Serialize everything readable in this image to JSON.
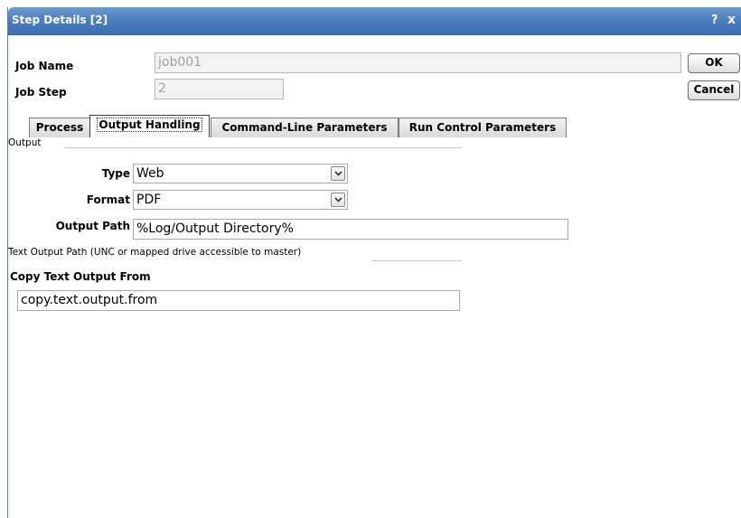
{
  "window": {
    "title": "Step Details [2]",
    "help_label": "?",
    "close_label": "x"
  },
  "header": {
    "job_name_label": "Job Name",
    "job_name_value": "job001",
    "job_step_label": "Job Step",
    "job_step_value": "2",
    "ok_label": "OK",
    "cancel_label": "Cancel"
  },
  "tabs": [
    {
      "label": "Process"
    },
    {
      "label": "Output Handling",
      "active": true
    },
    {
      "label": "Command-Line Parameters"
    },
    {
      "label": "Run Control Parameters"
    }
  ],
  "output": {
    "section_label": "Output",
    "type_label": "Type",
    "type_value": "Web",
    "format_label": "Format",
    "format_value": "PDF",
    "path_label": "Output Path",
    "path_value": "%Log/Output Directory%",
    "text_section_label": "Text Output Path (UNC or mapped drive accessible to master)",
    "copy_label": "Copy Text Output From",
    "copy_value": "copy.text.output.from"
  },
  "icons": {
    "dropdown": "chevron-down-icon"
  }
}
